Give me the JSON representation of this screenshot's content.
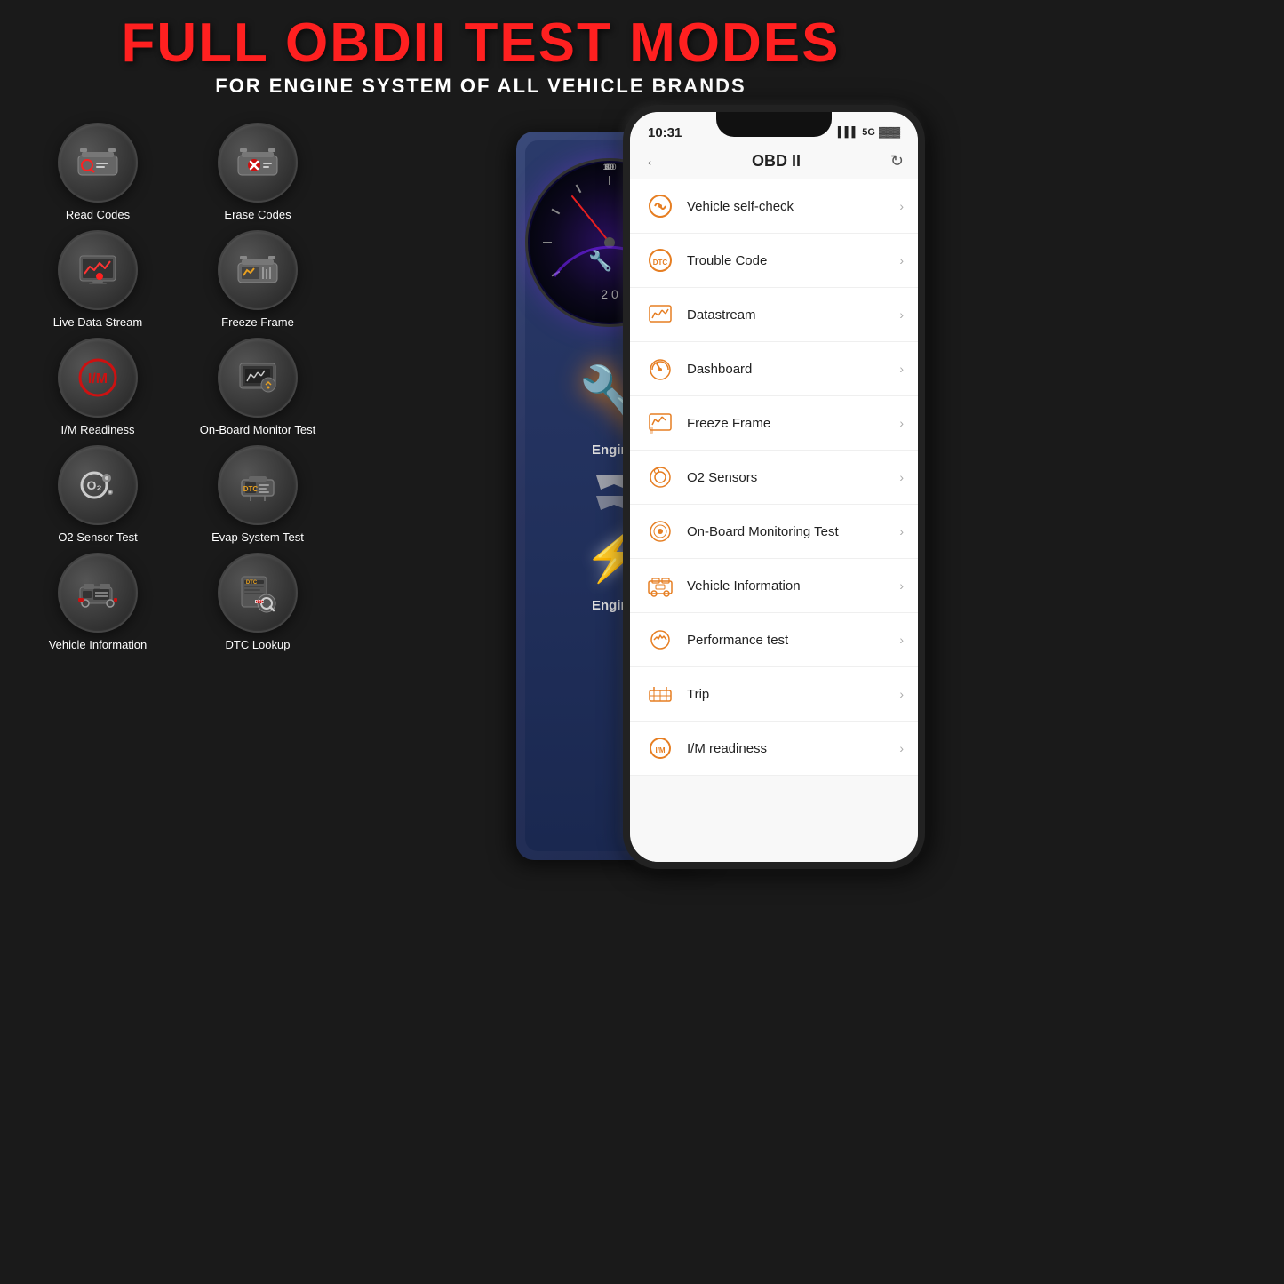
{
  "header": {
    "title": "FULL OBDII TEST MODES",
    "subtitle": "FOR ENGINE SYSTEM OF ALL VEHICLE BRANDS"
  },
  "icons": [
    {
      "id": "read-codes",
      "label": "Read Codes",
      "icon": "car-search"
    },
    {
      "id": "erase-codes",
      "label": "Erase Codes",
      "icon": "car-delete"
    },
    {
      "id": "live-data-stream",
      "label": "Live Data Stream",
      "icon": "chart-live"
    },
    {
      "id": "freeze-frame",
      "label": "Freeze Frame",
      "icon": "car-freeze"
    },
    {
      "id": "im-readiness",
      "label": "I/M Readiness",
      "icon": "im"
    },
    {
      "id": "on-board-monitor",
      "label": "On-Board Monitor Test",
      "icon": "monitor-gear"
    },
    {
      "id": "o2-sensor",
      "label": "O2 Sensor Test",
      "icon": "o2"
    },
    {
      "id": "evap-system",
      "label": "Evap System Test",
      "icon": "evap"
    },
    {
      "id": "vehicle-info",
      "label": "Vehicle Information",
      "icon": "car-info"
    },
    {
      "id": "dtc-lookup",
      "label": "DTC Lookup",
      "icon": "dtc-search"
    }
  ],
  "phone": {
    "time": "10:31",
    "signal": "5G",
    "app_title": "OBD II",
    "back_icon": "←",
    "refresh_icon": "↻",
    "menu_items": [
      {
        "id": "self-check",
        "label": "Vehicle self-check",
        "icon": "🔄",
        "color": "#e67e22"
      },
      {
        "id": "trouble-code",
        "label": "Trouble Code",
        "icon": "DTC",
        "color": "#e67e22"
      },
      {
        "id": "datastream",
        "label": "Datastream",
        "icon": "📊",
        "color": "#e67e22"
      },
      {
        "id": "dashboard",
        "label": "Dashboard",
        "icon": "🏎",
        "color": "#e67e22"
      },
      {
        "id": "freeze-frame",
        "label": "Freeze Frame",
        "icon": "📈",
        "color": "#e67e22"
      },
      {
        "id": "o2-sensors",
        "label": "O2 Sensors",
        "icon": "⭕",
        "color": "#e67e22"
      },
      {
        "id": "on-board-monitoring",
        "label": "On-Board Monitoring Test",
        "icon": "🔵",
        "color": "#e67e22"
      },
      {
        "id": "vehicle-info",
        "label": "Vehicle Information",
        "icon": "🚗",
        "color": "#e67e22"
      },
      {
        "id": "performance-test",
        "label": "Performance test",
        "icon": "⚙",
        "color": "#e67e22"
      },
      {
        "id": "trip",
        "label": "Trip",
        "icon": "🛣",
        "color": "#e67e22"
      },
      {
        "id": "im-readiness",
        "label": "I/M readiness",
        "icon": "I/M",
        "color": "#e67e22"
      }
    ]
  }
}
